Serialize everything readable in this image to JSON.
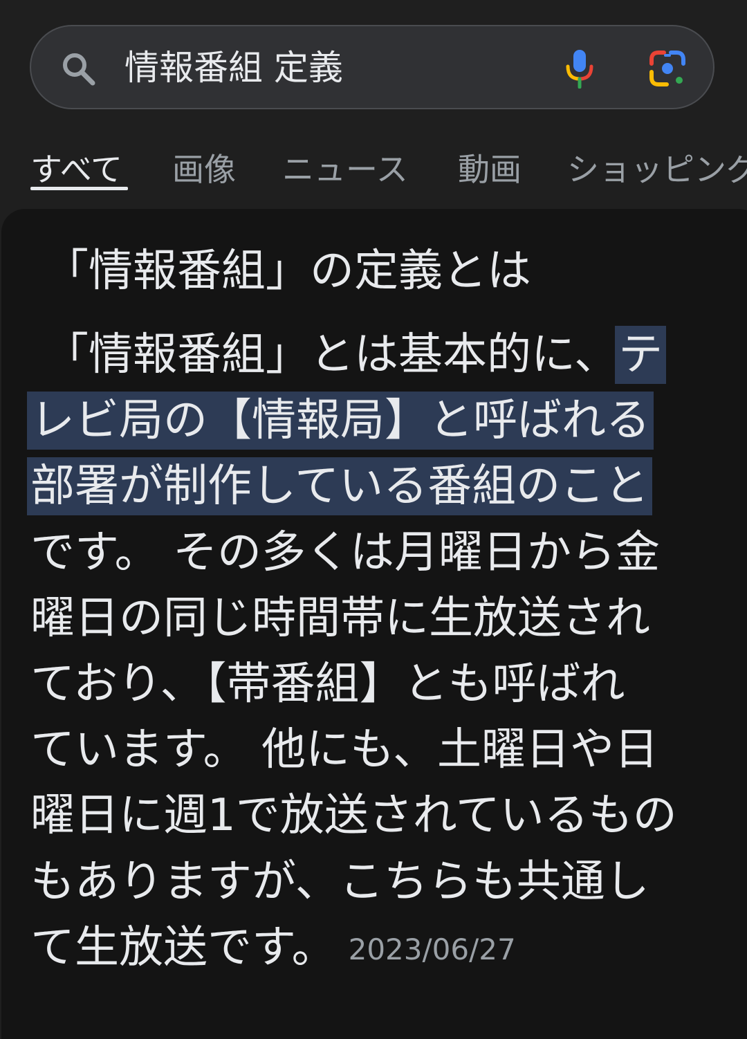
{
  "search": {
    "query": "情報番組 定義",
    "icons": [
      "search-icon",
      "mic-icon",
      "google-lens-icon"
    ]
  },
  "tabs": [
    {
      "label": "すべて",
      "active": true
    },
    {
      "label": "画像",
      "active": false
    },
    {
      "label": "ニュース",
      "active": false
    },
    {
      "label": "動画",
      "active": false
    },
    {
      "label": "ショッピング",
      "active": false
    }
  ],
  "result": {
    "title": "「情報番組」の定義とは",
    "line1_plain": "「情報番組」とは基本的に、",
    "line1_highlight": "テ",
    "line2_highlight": "レビ局の【情報局】と呼ばれる",
    "line3_highlight": "部署が制作している番組のこと",
    "line4": "です。 その多くは月曜日から金",
    "line5": "曜日の同じ時間帯に生放送され",
    "line6": "ており、【帯番組】とも呼ばれ",
    "line7": "ています。 他にも、土曜日や日",
    "line8": "曜日に週1で放送されているもの",
    "line9": "もありますが、こちらも共通し",
    "line10": "て生放送です。",
    "date": "2023/06/27"
  },
  "colors": {
    "background": "#1f1f1f",
    "card": "#141414",
    "highlight": "#2d3b55",
    "text": "#e8eaed",
    "muted": "#9aa0a6"
  }
}
